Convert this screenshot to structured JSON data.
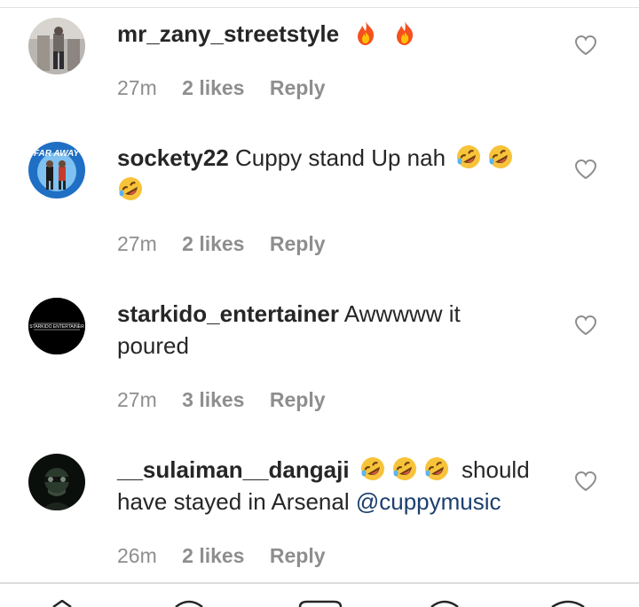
{
  "comments": [
    {
      "username": "mr_zany_streetstyle",
      "text_parts": [
        "",
        ""
      ],
      "emojis": [
        "fire",
        "fire"
      ],
      "time": "27m",
      "likes": "2 likes",
      "reply": "Reply"
    },
    {
      "username": "sockety22",
      "text_parts": [
        "Cuppy stand Up nah"
      ],
      "emojis": [
        "rofl",
        "rofl",
        "rofl"
      ],
      "time": "27m",
      "likes": "2 likes",
      "reply": "Reply"
    },
    {
      "username": "starkido_entertainer",
      "text_line1": "Awwwww it",
      "text_line2": "poured",
      "avatar_text": "STARKIDO ENTERTAINER",
      "time": "27m",
      "likes": "3 likes",
      "reply": "Reply"
    },
    {
      "username": "__sulaiman__dangaji",
      "text_after_emoji": "should",
      "text_line2": "have stayed in Arsenal",
      "mention": "@cuppymusic",
      "emojis": [
        "rofl",
        "rofl",
        "rofl"
      ],
      "time": "26m",
      "likes": "2 likes",
      "reply": "Reply"
    }
  ],
  "colors": {
    "text": "#262626",
    "meta": "#8e8e8e",
    "mention": "#1c3f6e",
    "divider": "#dcdcdc"
  },
  "icons": {
    "like": "heart-outline-icon",
    "fire": "fire-emoji",
    "rofl": "rofl-emoji"
  }
}
